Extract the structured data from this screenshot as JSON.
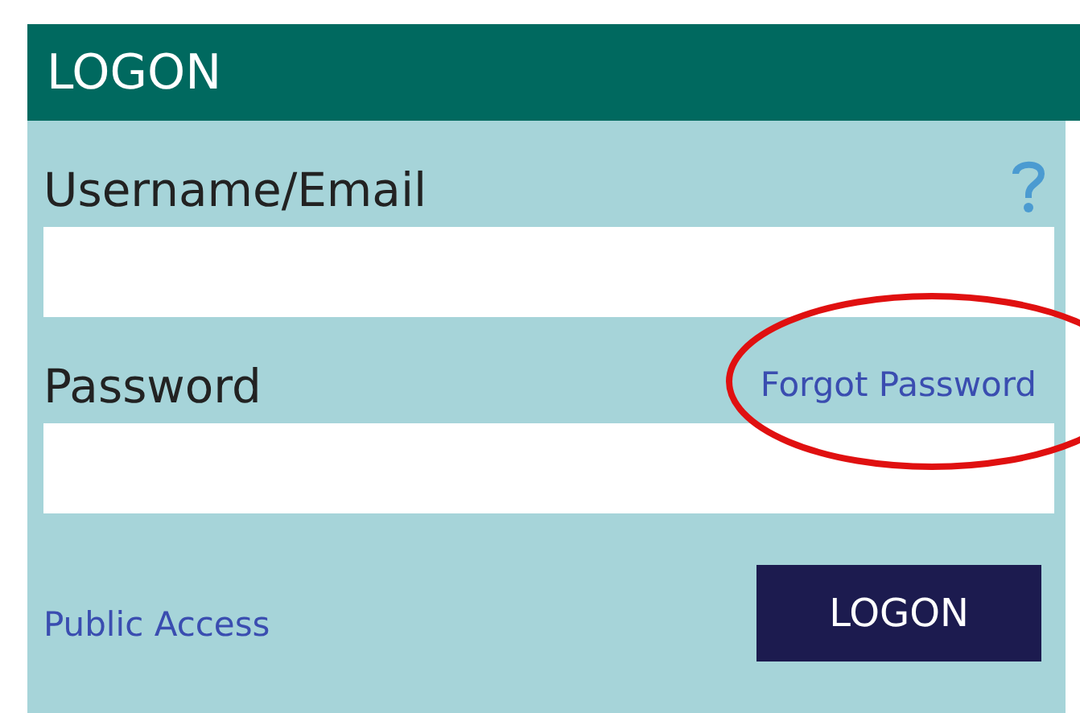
{
  "title": "LOGON",
  "fields": [
    {
      "label": "Username/Email",
      "kind": "help"
    },
    {
      "label": "Password",
      "kind": "link",
      "link": "Forgot Password",
      "circled": true
    }
  ],
  "public_access": "Public Access",
  "button": "LOGON"
}
